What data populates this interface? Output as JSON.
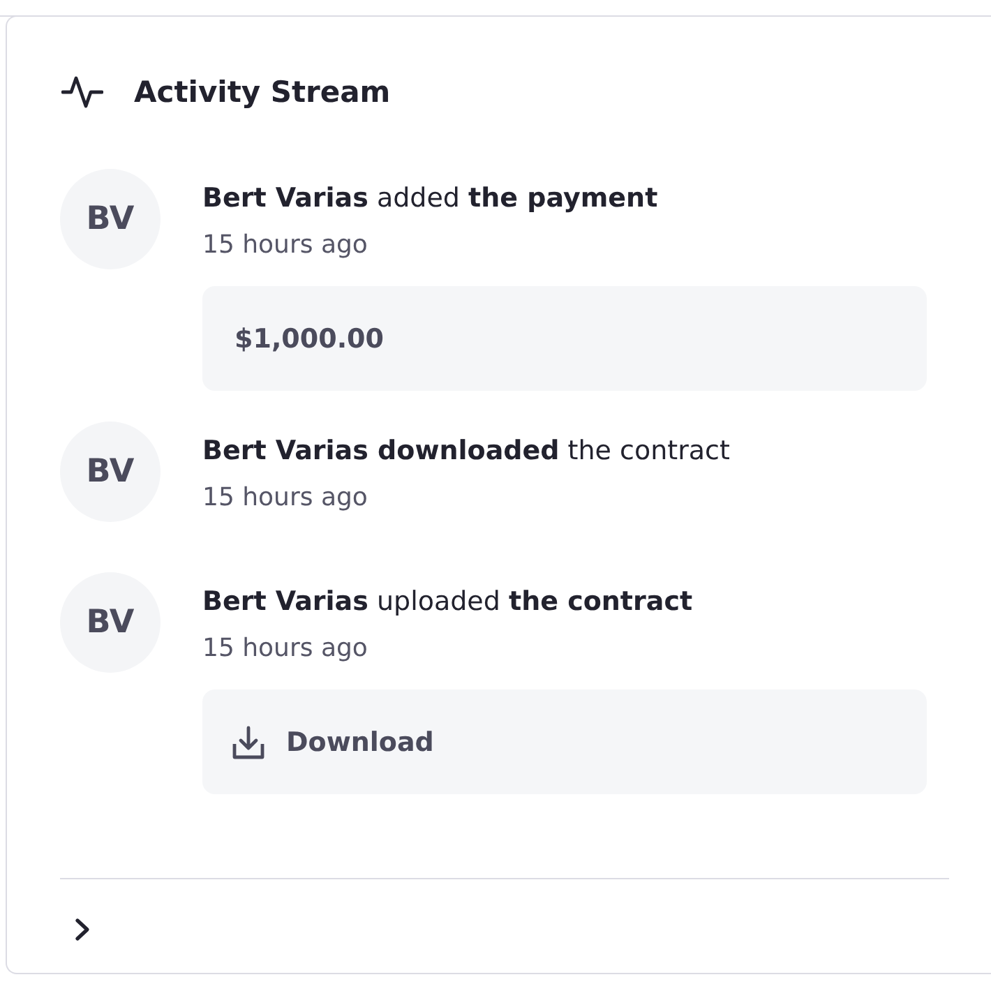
{
  "card": {
    "title": "Activity Stream"
  },
  "activities": [
    {
      "avatar": "BV",
      "summary": "**Bert Varias** added **the payment**",
      "time": "15 hours ago",
      "attachment": {
        "kind": "amount",
        "text": "$1,000.00"
      }
    },
    {
      "avatar": "BV",
      "summary": "**Bert Varias downloaded** the contract",
      "time": "15 hours ago"
    },
    {
      "avatar": "BV",
      "summary": "**Bert Varias** uploaded **the contract**",
      "time": "15 hours ago",
      "attachment": {
        "kind": "download",
        "text": "Download"
      }
    }
  ],
  "footer": {
    "expanded": false
  }
}
